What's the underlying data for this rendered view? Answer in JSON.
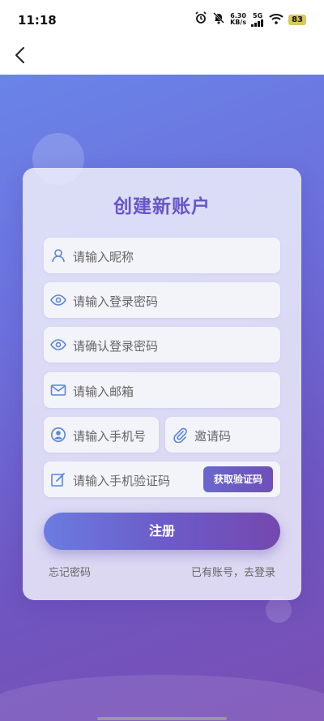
{
  "status_bar": {
    "time": "11:18",
    "net_speed_value": "6.30",
    "net_speed_unit": "KB/s",
    "network": "5G",
    "battery": "83"
  },
  "form": {
    "title": "创建新账户",
    "nickname_placeholder": "请输入昵称",
    "password_placeholder": "请输入登录密码",
    "confirm_password_placeholder": "请确认登录密码",
    "email_placeholder": "请输入邮箱",
    "phone_placeholder": "请输入手机号",
    "invite_code_placeholder": "邀请码",
    "sms_code_placeholder": "请输入手机验证码",
    "get_code_label": "获取验证码",
    "submit_label": "注册",
    "forgot_password_label": "忘记密码",
    "login_link_label": "已有账号，去登录"
  },
  "colors": {
    "accent": "#6656c8",
    "icon": "#5a86d8",
    "gradient_start": "#6a84e8",
    "gradient_end": "#7a4fb4"
  }
}
